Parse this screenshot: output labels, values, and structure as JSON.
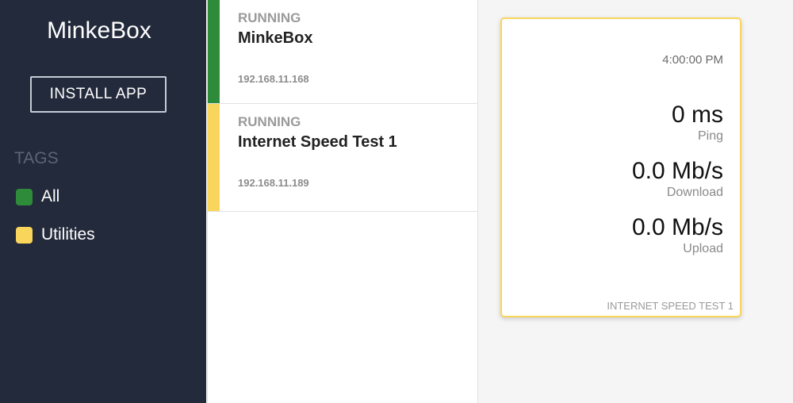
{
  "sidebar": {
    "brand": "MinkeBox",
    "install_label": "INSTALL APP",
    "tags_heading": "TAGS",
    "tags": [
      {
        "label": "All",
        "color": "#2e8b3a"
      },
      {
        "label": "Utilities",
        "color": "#f9d65b"
      }
    ]
  },
  "apps": [
    {
      "status": "RUNNING",
      "name": "MinkeBox",
      "ip": "192.168.11.168",
      "color": "#2e8b3a"
    },
    {
      "status": "RUNNING",
      "name": "Internet Speed Test 1",
      "ip": "192.168.11.189",
      "color": "#f9d65b"
    }
  ],
  "widget": {
    "time": "4:00:00 PM",
    "ping_value": "0 ms",
    "ping_label": "Ping",
    "download_value": "0.0 Mb/s",
    "download_label": "Download",
    "upload_value": "0.0 Mb/s",
    "upload_label": "Upload",
    "name": "INTERNET SPEED TEST 1",
    "border_color": "#f9d65b"
  }
}
